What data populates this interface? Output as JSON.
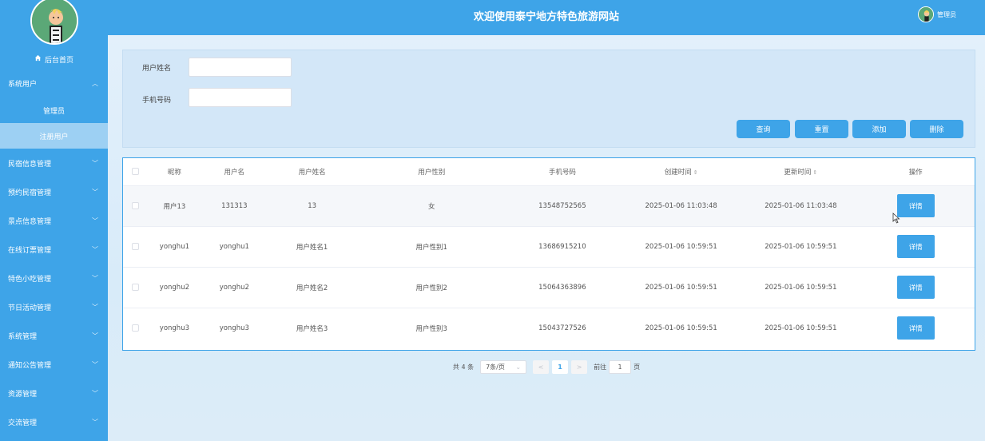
{
  "header": {
    "title": "欢迎使用泰宁地方特色旅游网站",
    "user_label": "管理员"
  },
  "sidebar": {
    "home_label": "后台首页",
    "system_user": {
      "label": "系统用户",
      "sub_items": [
        {
          "label": "管理员"
        },
        {
          "label": "注册用户"
        }
      ]
    },
    "menus": [
      {
        "label": "民宿信息管理"
      },
      {
        "label": "预约民宿管理"
      },
      {
        "label": "景点信息管理"
      },
      {
        "label": "在线订票管理"
      },
      {
        "label": "特色小吃管理"
      },
      {
        "label": "节日活动管理"
      },
      {
        "label": "系统管理"
      },
      {
        "label": "通知公告管理"
      },
      {
        "label": "资源管理"
      },
      {
        "label": "交流管理"
      }
    ]
  },
  "search": {
    "name_label": "用户姓名",
    "phone_label": "手机号码",
    "name_value": "",
    "phone_value": ""
  },
  "buttons": {
    "query": "查询",
    "reset": "重置",
    "add": "添加",
    "delete": "删除"
  },
  "table": {
    "headers": {
      "nickname": "昵称",
      "username": "用户名",
      "realname": "用户姓名",
      "gender": "用户性别",
      "phone": "手机号码",
      "created": "创建时间",
      "updated": "更新时间",
      "actions": "操作"
    },
    "detail_label": "详情",
    "rows": [
      {
        "nickname": "用户13",
        "username": "131313",
        "realname": "13",
        "gender": "女",
        "phone": "13548752565",
        "created": "2025-01-06 11:03:48",
        "updated": "2025-01-06 11:03:48"
      },
      {
        "nickname": "yonghu1",
        "username": "yonghu1",
        "realname": "用户姓名1",
        "gender": "用户性别1",
        "phone": "13686915210",
        "created": "2025-01-06 10:59:51",
        "updated": "2025-01-06 10:59:51"
      },
      {
        "nickname": "yonghu2",
        "username": "yonghu2",
        "realname": "用户姓名2",
        "gender": "用户性别2",
        "phone": "15064363896",
        "created": "2025-01-06 10:59:51",
        "updated": "2025-01-06 10:59:51"
      },
      {
        "nickname": "yonghu3",
        "username": "yonghu3",
        "realname": "用户姓名3",
        "gender": "用户性别3",
        "phone": "15043727526",
        "created": "2025-01-06 10:59:51",
        "updated": "2025-01-06 10:59:51"
      }
    ]
  },
  "pagination": {
    "total": "共 4 条",
    "page_size": "7条/页",
    "prev": "<",
    "current": "1",
    "next": ">",
    "goto_prefix": "前往",
    "goto_value": "1",
    "goto_suffix": "页"
  },
  "colors": {
    "primary": "#3ea4e8",
    "active_sub": "#9dd0f3"
  }
}
